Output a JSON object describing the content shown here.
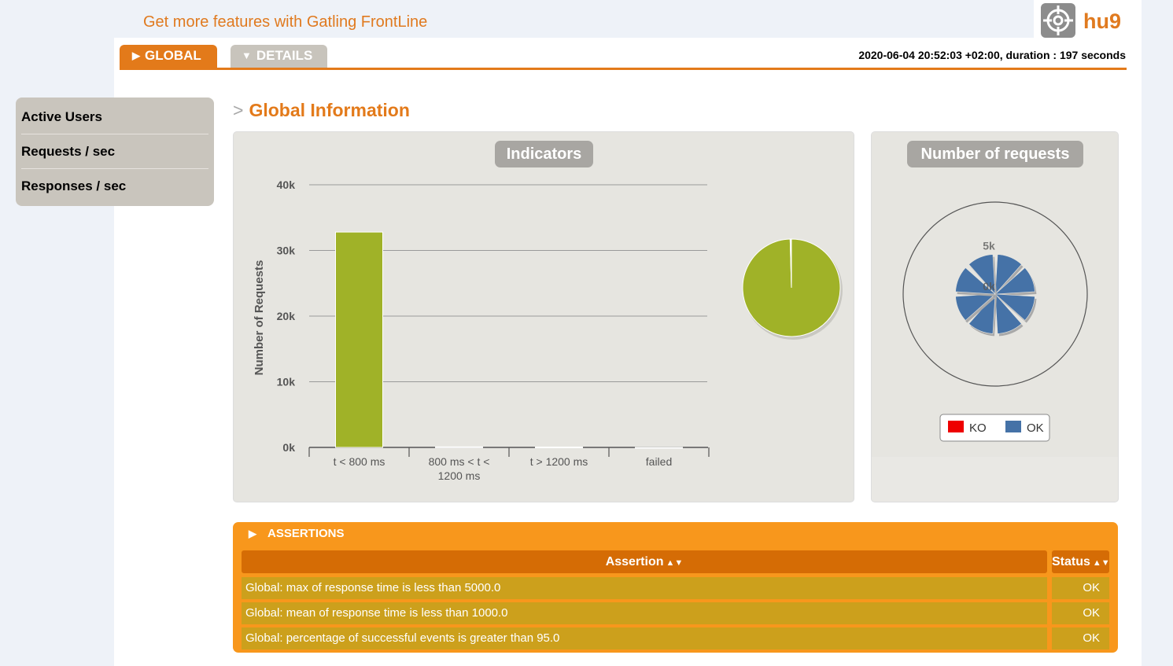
{
  "header": {
    "frontline_link": "Get more features with Gatling FrontLine",
    "brand_name": "hu9"
  },
  "tabs": [
    {
      "label": "GLOBAL"
    },
    {
      "label": "DETAILS"
    }
  ],
  "run_info": "2020-06-04 20:52:03 +02:00, duration : 197 seconds",
  "sidebar": {
    "items": [
      {
        "label": "Active Users"
      },
      {
        "label": "Requests / sec"
      },
      {
        "label": "Responses / sec"
      }
    ]
  },
  "section_title": "Global Information",
  "chart_data": [
    {
      "type": "bar",
      "title": "Indicators",
      "ylabel": "Number of Requests",
      "categories": [
        "t < 800 ms",
        "800 ms < t < 1200 ms",
        "t > 1200 ms",
        "failed"
      ],
      "values": [
        32800,
        80,
        60,
        0
      ],
      "ylim": [
        0,
        40000
      ],
      "y_ticks": [
        "0k",
        "10k",
        "20k",
        "30k",
        "40k"
      ],
      "grid": true,
      "color": "#a0b228",
      "pie": {
        "type": "pie",
        "values": [
          32800,
          80,
          60,
          0
        ],
        "colors": [
          "#a0b228",
          "#f3e66e",
          "#f0b429",
          "#d93d3d"
        ]
      }
    },
    {
      "type": "polar",
      "title": "Number of requests",
      "series": [
        {
          "name": "KO",
          "color": "#ee0000",
          "values": [
            0,
            0,
            0,
            0,
            0,
            0,
            0,
            0
          ]
        },
        {
          "name": "OK",
          "color": "#4572a7",
          "values": [
            4100,
            4100,
            4100,
            4100,
            4100,
            4100,
            4100,
            4100
          ]
        }
      ],
      "radial_ticks": [
        "0k",
        "5k"
      ],
      "rmax": 9500
    }
  ],
  "assertions": {
    "title": "ASSERTIONS",
    "header_assertion": "Assertion",
    "header_status": "Status",
    "rows": [
      {
        "assertion": "Global: max of response time is less than 5000.0",
        "status": "OK"
      },
      {
        "assertion": "Global: mean of response time is less than 1000.0",
        "status": "OK"
      },
      {
        "assertion": "Global: percentage of successful events is greater than 95.0",
        "status": "OK"
      }
    ]
  }
}
